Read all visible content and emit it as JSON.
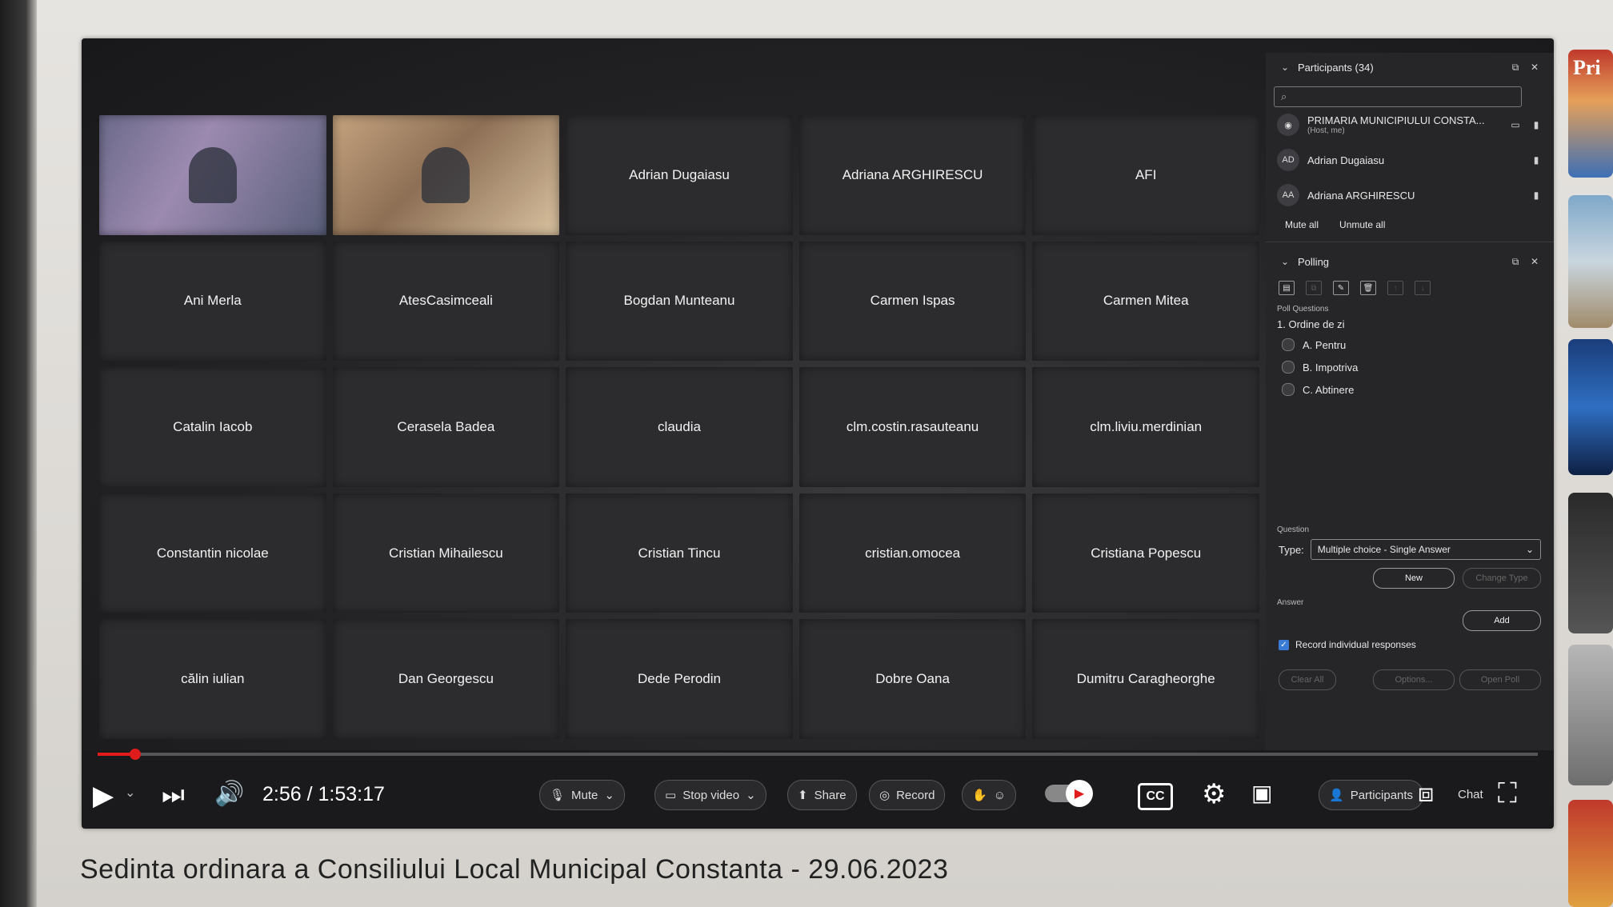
{
  "video": {
    "title": "Sedinta ordinara a Consiliului Local Municipal Constanta - 29.06.2023",
    "time": "2:56 / 1:53:17",
    "progress": 0.026
  },
  "meeting": {
    "tiles": [
      {
        "name": "",
        "video": true
      },
      {
        "name": "",
        "video": true
      },
      {
        "name": "Adrian Dugaiasu"
      },
      {
        "name": "Adriana ARGHIRESCU"
      },
      {
        "name": "AFI"
      },
      {
        "name": "Ani Merla"
      },
      {
        "name": "AtesCasimceali"
      },
      {
        "name": "Bogdan Munteanu"
      },
      {
        "name": "Carmen Ispas"
      },
      {
        "name": "Carmen Mitea"
      },
      {
        "name": "Catalin Iacob"
      },
      {
        "name": "Cerasela Badea"
      },
      {
        "name": "claudia"
      },
      {
        "name": "clm.costin.rasauteanu"
      },
      {
        "name": "clm.liviu.merdinian"
      },
      {
        "name": "Constantin nicolae"
      },
      {
        "name": "Cristian Mihailescu"
      },
      {
        "name": "Cristian Tincu"
      },
      {
        "name": "cristian.omocea"
      },
      {
        "name": "Cristiana Popescu"
      },
      {
        "name": "călin iulian"
      },
      {
        "name": "Dan Georgescu"
      },
      {
        "name": "Dede Perodin"
      },
      {
        "name": "Dobre Oana"
      },
      {
        "name": "Dumitru Caragheorghe"
      }
    ],
    "toolbar": {
      "mute": "Mute",
      "stop_video": "Stop video",
      "share": "Share",
      "record": "Record",
      "participants": "Participants",
      "chat": "Chat"
    }
  },
  "participants_panel": {
    "title": "Participants (34)",
    "list": [
      {
        "initials": "",
        "name": "PRIMARIA MUNICIPIULUI CONSTA...",
        "sub": "(Host, me)"
      },
      {
        "initials": "AD",
        "name": "Adrian Dugaiasu"
      },
      {
        "initials": "AA",
        "name": "Adriana ARGHIRESCU"
      }
    ],
    "mute_all": "Mute all",
    "unmute_all": "Unmute all"
  },
  "polling": {
    "title": "Polling",
    "questions_label": "Poll Questions",
    "question": "1.  Ordine de zi",
    "options": [
      "A. Pentru",
      "B. Impotriva",
      "C. Abtinere"
    ],
    "question_label": "Question",
    "type_label": "Type:",
    "type_value": "Multiple choice - Single Answer",
    "new_btn": "New",
    "change_type_btn": "Change Type",
    "answer_label": "Answer",
    "add_btn": "Add",
    "record_label": "Record individual responses",
    "clear_all": "Clear All",
    "options_btn": "Options...",
    "open_poll": "Open Poll"
  },
  "sidebar_thumb": {
    "text": "Pri"
  },
  "colors": {
    "progress": "#e01b1b",
    "panel_bg": "#262628",
    "tile_bg": "#2c2c2e"
  }
}
